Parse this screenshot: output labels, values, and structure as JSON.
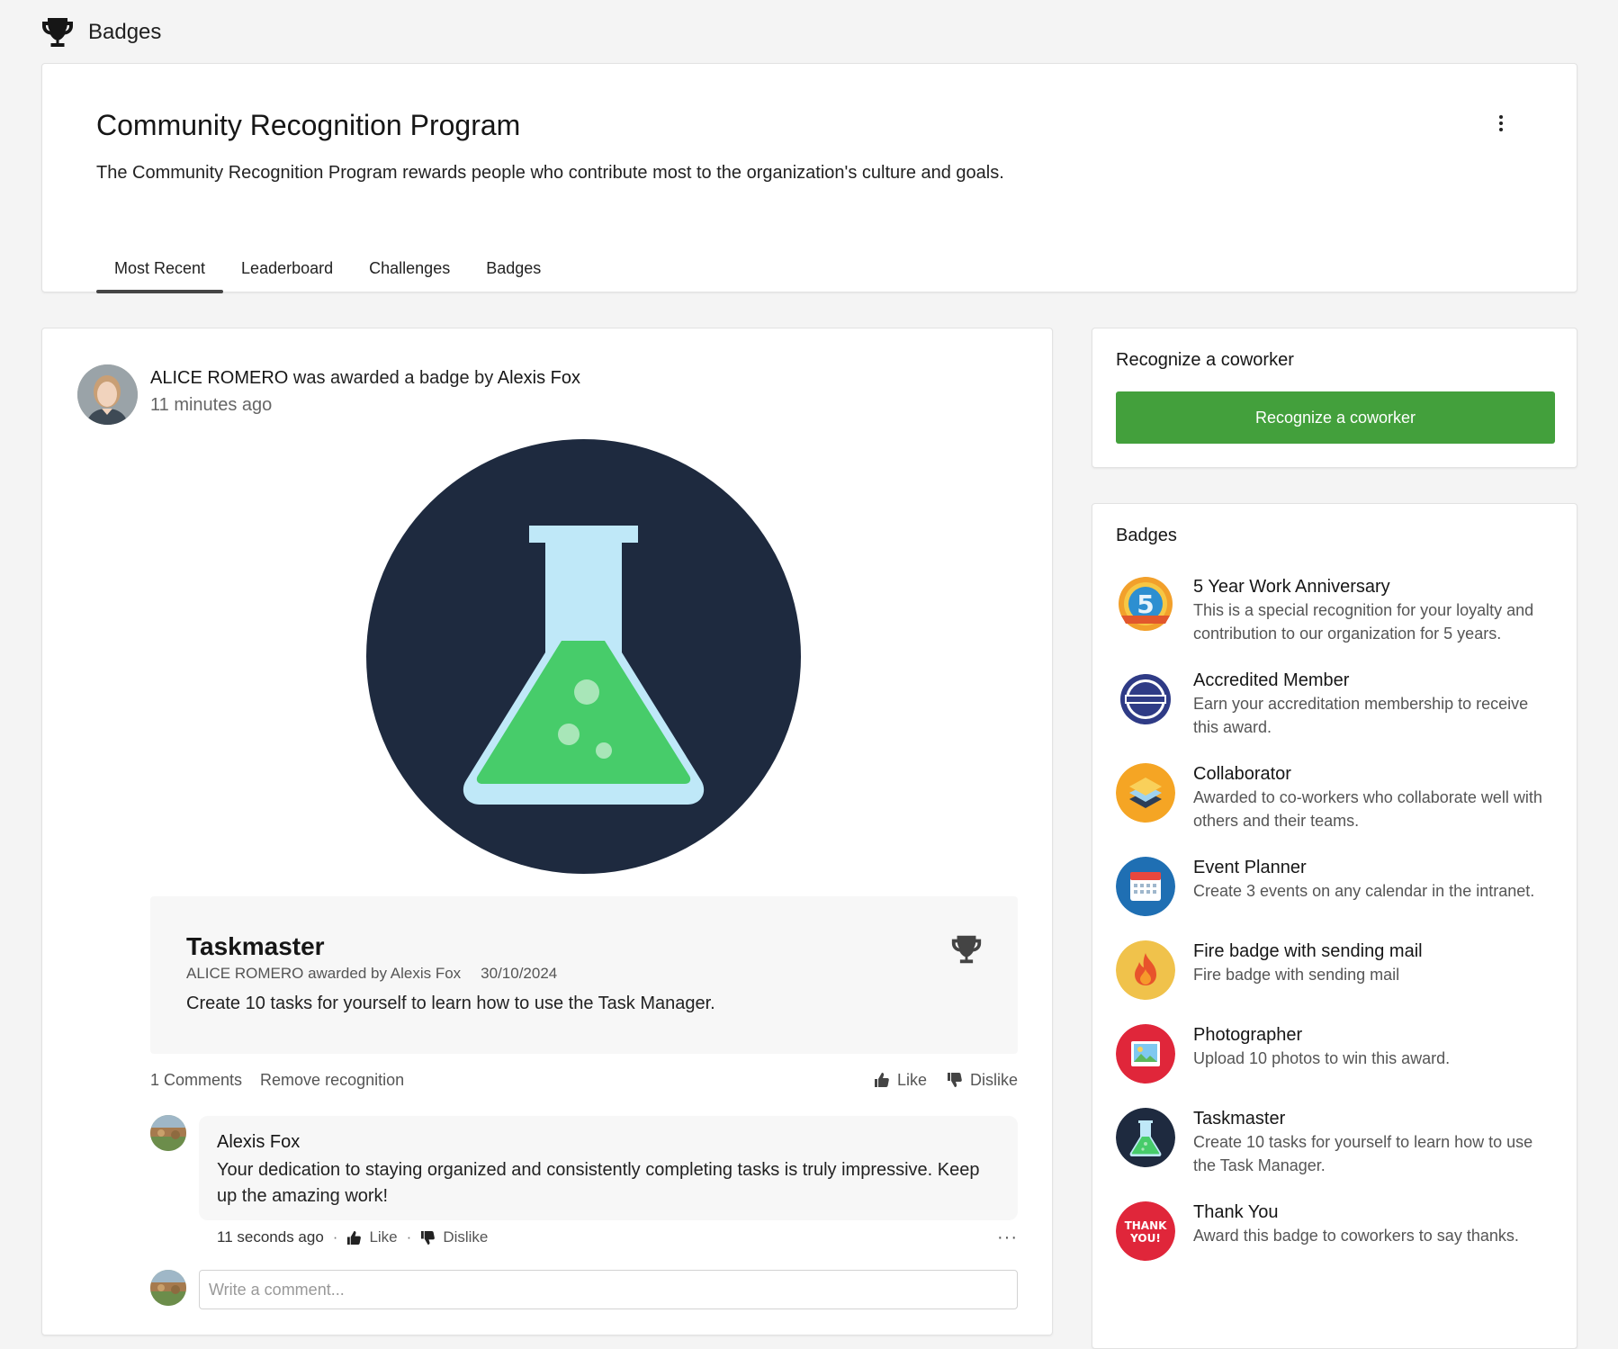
{
  "header": {
    "title": "Badges",
    "icon": "trophy-icon"
  },
  "program": {
    "title": "Community Recognition Program",
    "description": "The Community Recognition Program rewards people who contribute most to the organization's culture and goals.",
    "tabs": [
      {
        "label": "Most Recent",
        "active": true
      },
      {
        "label": "Leaderboard"
      },
      {
        "label": "Challenges"
      },
      {
        "label": "Badges"
      }
    ]
  },
  "feed": {
    "recipient": "ALICE ROMERO",
    "awarded_text": " was awarded a badge by ",
    "awarder": "Alexis Fox",
    "time": "11 minutes ago",
    "badge": {
      "name": "Taskmaster",
      "meta": "ALICE ROMERO awarded by Alexis Fox",
      "date": "30/10/2024",
      "description": "Create 10 tasks for yourself to learn how to use the Task Manager."
    },
    "comments_count": "1 Comments",
    "remove_label": "Remove recognition",
    "like_label": "Like",
    "dislike_label": "Dislike",
    "comment": {
      "author": "Alexis Fox",
      "text": "Your dedication to staying organized and consistently completing tasks is truly impressive. Keep up the amazing work!",
      "time": "11 seconds ago",
      "like_label": "Like",
      "dislike_label": "Dislike",
      "more": "···"
    },
    "comment_placeholder": "Write a comment..."
  },
  "sidebar": {
    "recognize_title": "Recognize a coworker",
    "recognize_button": "Recognize a coworker",
    "badges_title": "Badges",
    "badges": [
      {
        "title": "5 Year Work Anniversary",
        "desc": "This is a special recognition for your loyalty and contribution to our organization for 5 years.",
        "icon": "anniversary-5-icon"
      },
      {
        "title": "Accredited Member",
        "desc": "Earn your accreditation membership to receive this award.",
        "icon": "accredited-seal-icon"
      },
      {
        "title": "Collaborator",
        "desc": "Awarded to co-workers who collaborate well with others and their teams.",
        "icon": "layers-icon"
      },
      {
        "title": "Event Planner",
        "desc": "Create 3 events on any calendar in the intranet.",
        "icon": "calendar-icon"
      },
      {
        "title": "Fire badge with sending mail",
        "desc": "Fire badge with sending mail",
        "icon": "flame-icon"
      },
      {
        "title": "Photographer",
        "desc": "Upload 10 photos to win this award.",
        "icon": "photo-icon"
      },
      {
        "title": "Taskmaster",
        "desc": "Create 10 tasks for yourself to learn how to use the Task Manager.",
        "icon": "flask-icon"
      },
      {
        "title": "Thank You",
        "desc": "Award this badge to coworkers to say thanks.",
        "icon": "thank-you-icon",
        "icon_text_1": "THANK",
        "icon_text_2": "YOU!"
      }
    ]
  },
  "colors": {
    "accent_green": "#43a03c",
    "flask_bg": "#1e2a3f",
    "flask_glass": "#bfe8f8",
    "flask_liquid": "#47cc6a"
  }
}
